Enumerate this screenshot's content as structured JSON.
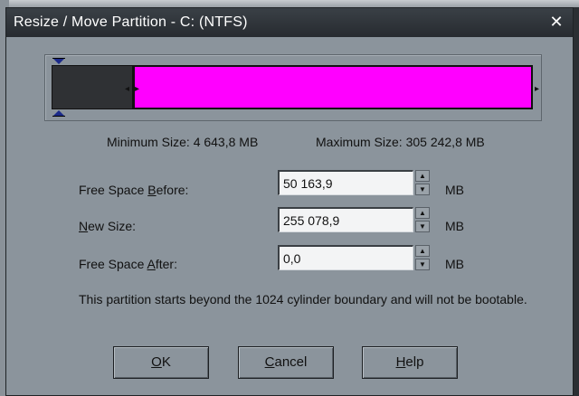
{
  "window": {
    "title": "Resize / Move Partition - C:  (NTFS)",
    "close_icon": "close-icon"
  },
  "partition_bar": {
    "used_color": "#2f3134",
    "partition_color": "#ff00ff"
  },
  "sizes": {
    "minimum_label": "Minimum Size:",
    "minimum_value": "4 643,8 MB",
    "maximum_label": "Maximum Size:",
    "maximum_value": "305 242,8 MB"
  },
  "fields": {
    "free_before": {
      "label_pre": "Free Space ",
      "label_underlined": "B",
      "label_post": "efore:",
      "value": "50 163,9",
      "unit": "MB"
    },
    "new_size": {
      "label_pre": "",
      "label_underlined": "N",
      "label_post": "ew Size:",
      "value": "255 078,9",
      "unit": "MB"
    },
    "free_after": {
      "label_pre": "Free Space ",
      "label_underlined": "A",
      "label_post": "fter:",
      "value": "0,0",
      "unit": "MB"
    }
  },
  "note": "This partition starts beyond the 1024 cylinder boundary and will not be bootable.",
  "buttons": {
    "ok": {
      "underlined": "O",
      "rest": "K"
    },
    "cancel": {
      "underlined": "C",
      "rest": "ancel"
    },
    "help": {
      "underlined": "H",
      "rest": "elp"
    }
  }
}
